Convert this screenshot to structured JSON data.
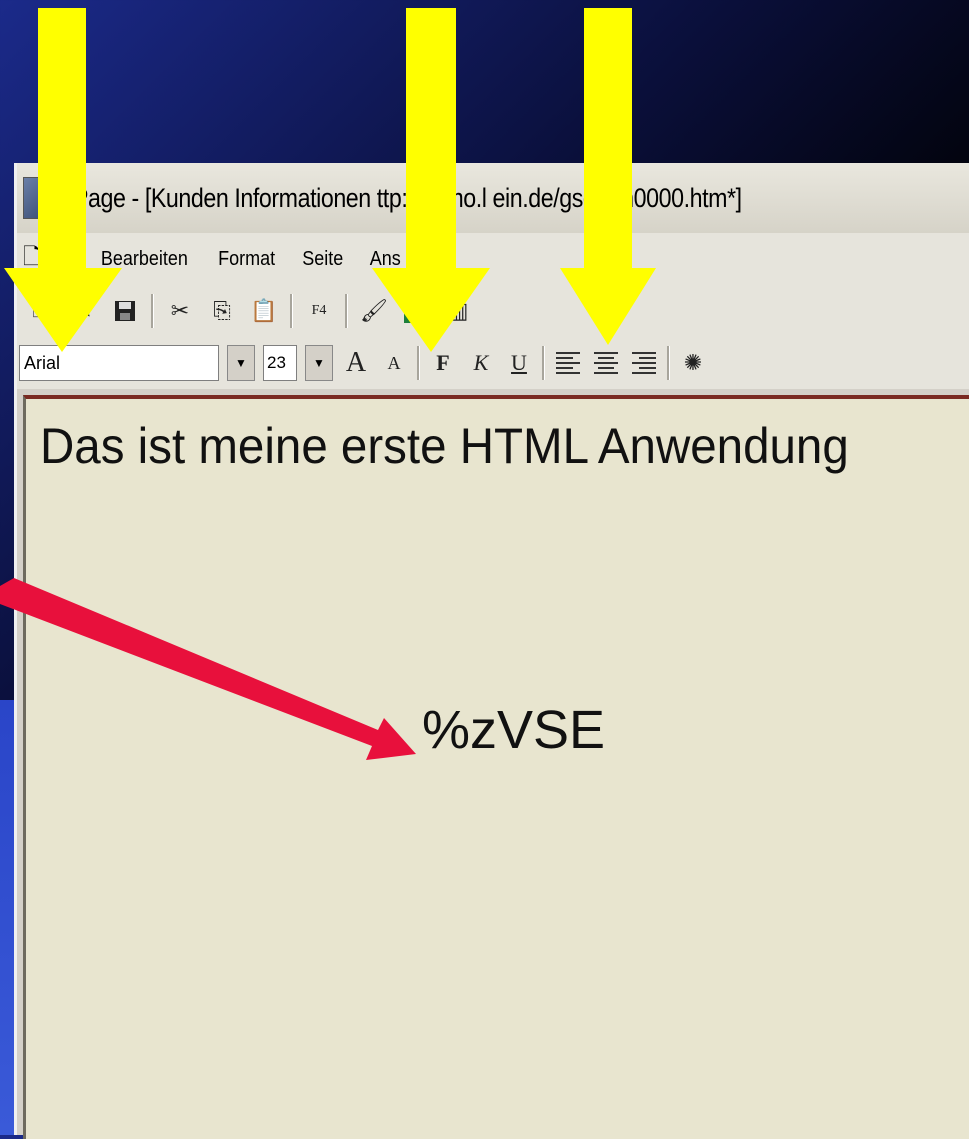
{
  "window": {
    "title": "Page - [Kunden Informationen   ttp://demo.l      ein.de/gse/brh0000.htm*]"
  },
  "menu": {
    "items": [
      "ei",
      "Bearbeiten",
      "Format",
      "Seite",
      "Ans",
      "?"
    ]
  },
  "toolbar_format": {
    "font_name": "Arial",
    "font_size": "23",
    "bold_label": "F",
    "italic_label": "K",
    "underline_label": "U"
  },
  "toolbar_standard": {
    "f4_label": "F4"
  },
  "editor": {
    "heading": "Das ist meine erste HTML Anwendung",
    "placeholder": "%zVSE"
  },
  "colors": {
    "highlight_arrow": "#ffff00",
    "pointer_arrow": "#e8103c",
    "canvas_bg": "#e8e5cf"
  },
  "icons": {
    "new": "new-document-icon",
    "save": "save-icon",
    "cut": "cut-icon",
    "copy": "copy-icon",
    "paste": "paste-icon",
    "image": "image-icon",
    "grow_font": "grow-font-icon",
    "shrink_font": "shrink-font-icon",
    "align_left": "align-left-icon",
    "align_center": "align-center-icon",
    "align_right": "align-right-icon"
  }
}
